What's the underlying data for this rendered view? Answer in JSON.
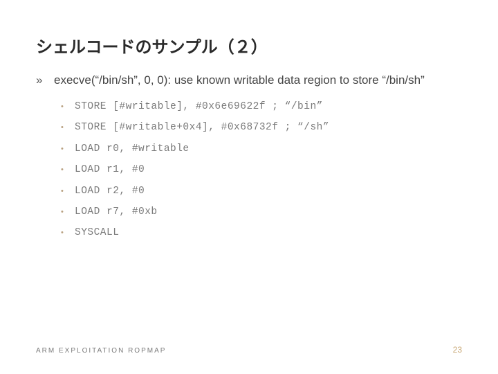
{
  "title": "シェルコードのサンプル（２）",
  "main": {
    "bullet": "»",
    "text": "execve(“/bin/sh”, 0, 0): use known writable data region to store “/bin/sh”"
  },
  "items": [
    "STORE [#writable], #0x6e69622f ; “/bin”",
    "STORE [#writable+0x4], #0x68732f ; “/sh”",
    "LOAD r0, #writable",
    "LOAD r1, #0",
    "LOAD r2, #0",
    "LOAD r7, #0xb",
    "SYSCALL"
  ],
  "sub_bullet": "•",
  "footer": {
    "left": "ARM EXPLOITATION ROPMAP",
    "right": "23"
  }
}
